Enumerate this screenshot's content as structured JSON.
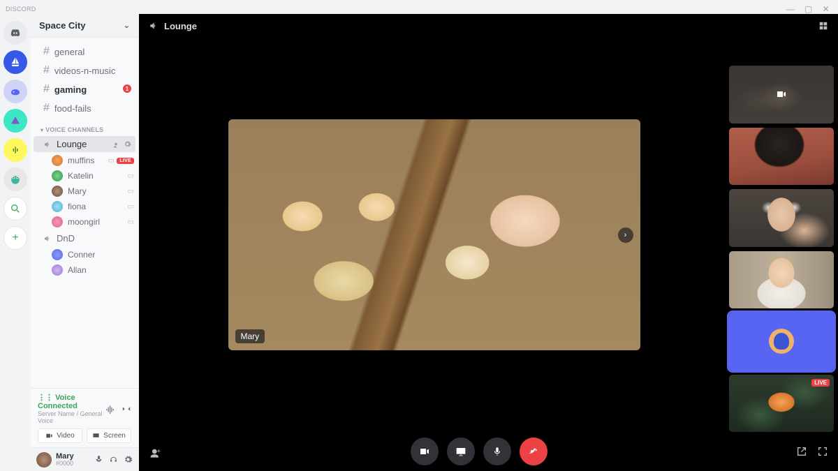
{
  "titlebar": {
    "app": "DISCORD"
  },
  "server": {
    "name": "Space City"
  },
  "text_channels": [
    {
      "name": "general",
      "unread": false
    },
    {
      "name": "videos-n-music",
      "unread": false
    },
    {
      "name": "gaming",
      "unread": true,
      "badge": "1"
    },
    {
      "name": "food-fails",
      "unread": false
    }
  ],
  "voice_category": "VOICE CHANNELS",
  "voice_channels": [
    {
      "name": "Lounge",
      "active": true,
      "members": [
        {
          "name": "muffins",
          "live": true
        },
        {
          "name": "Katelin"
        },
        {
          "name": "Mary"
        },
        {
          "name": "fiona"
        },
        {
          "name": "moongirl"
        }
      ]
    },
    {
      "name": "DnD",
      "active": false,
      "members": [
        {
          "name": "Conner"
        },
        {
          "name": "Allan"
        }
      ]
    }
  ],
  "voice_status": {
    "label": "Voice Connected",
    "sub": "Server Name / General Voice",
    "btn_video": "Video",
    "btn_screen": "Screen"
  },
  "user": {
    "name": "Mary",
    "tag": "#0000"
  },
  "call": {
    "channel": "Lounge",
    "focus_user": "Mary",
    "live_label": "LIVE"
  }
}
